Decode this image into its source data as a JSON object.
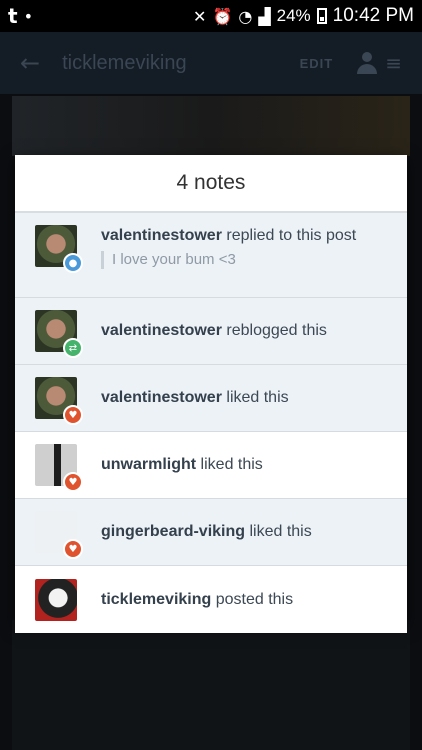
{
  "statusbar": {
    "app_icon": "t",
    "battery": "24%",
    "time": "10:42 PM"
  },
  "appbar": {
    "title": "ticklemeviking",
    "edit_label": "EDIT"
  },
  "modal": {
    "title": "4 notes",
    "notes": [
      {
        "user": "valentinestower",
        "action": " replied to this post",
        "reply": "I love your bum <3",
        "badge": "reply"
      },
      {
        "user": "valentinestower",
        "action": " reblogged this",
        "badge": "reblog"
      },
      {
        "user": "valentinestower",
        "action": " liked this",
        "badge": "like"
      },
      {
        "user": "unwarmlight",
        "action": " liked this",
        "badge": "like"
      },
      {
        "user": "gingerbeard-viking",
        "action": " liked this",
        "badge": "like"
      },
      {
        "user": "ticklemeviking",
        "action": " posted this"
      }
    ]
  },
  "colors": {
    "reply": "#4a9ad9",
    "reblog": "#45b36b",
    "like": "#e0532f"
  }
}
